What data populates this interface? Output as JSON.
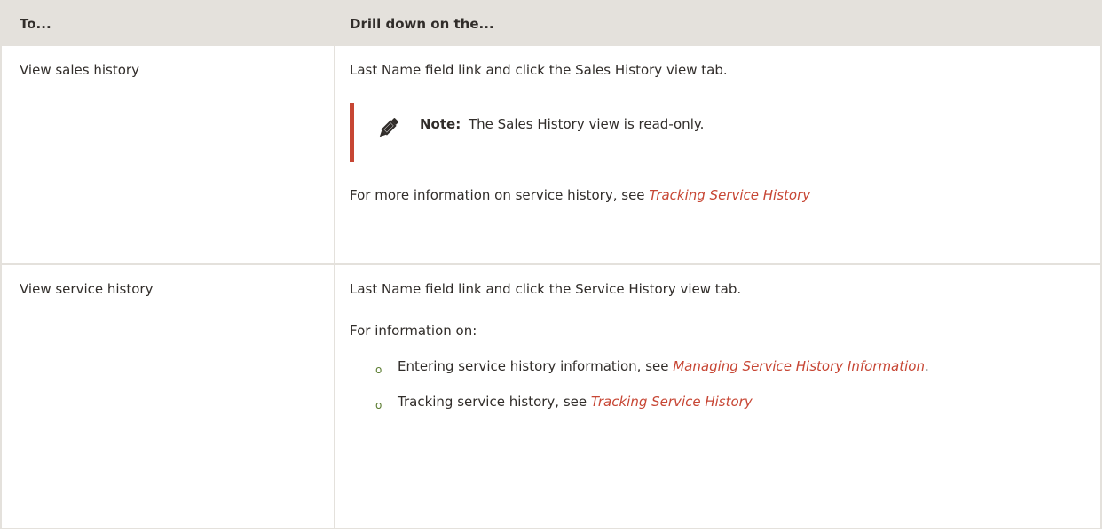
{
  "table": {
    "headers": [
      "To...",
      "Drill down on the..."
    ],
    "rows": [
      {
        "action": "View sales history",
        "instruction": "Last Name field link and click the Sales History view tab.",
        "note": {
          "label": "Note:",
          "text": "The Sales History view is read-only.",
          "icon": "pencil-icon"
        },
        "more_info_prefix": "For more information on service history, see ",
        "more_info_link": "Tracking Service History"
      },
      {
        "action": "View service history",
        "instruction": "Last Name field link and click the Service History view tab.",
        "info_intro": "For information on:",
        "bullet_glyph": "o",
        "bullets": [
          {
            "prefix": "Entering service history information, see ",
            "link": "Managing Service History Information",
            "suffix": "."
          },
          {
            "prefix": "Tracking service history, see ",
            "link": "Tracking Service History",
            "suffix": ""
          }
        ]
      }
    ]
  },
  "colors": {
    "header_bg": "#e4e1dc",
    "link": "#c74634",
    "note_bar": "#c74634",
    "bullet": "#5c7d32",
    "text": "#312d2a"
  }
}
